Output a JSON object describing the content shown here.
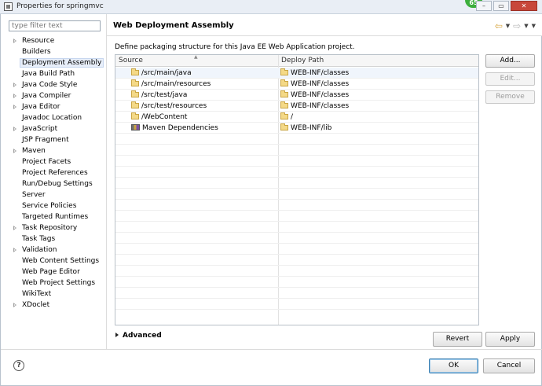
{
  "window": {
    "title": "Properties for springmvc",
    "badge": "65",
    "minimize": "–",
    "restore": "▭",
    "close": "✕"
  },
  "sidebar": {
    "filter_placeholder": "type filter text",
    "items": [
      {
        "label": "Resource",
        "expandable": true
      },
      {
        "label": "Builders",
        "expandable": false
      },
      {
        "label": "Deployment Assembly",
        "expandable": false,
        "selected": true
      },
      {
        "label": "Java Build Path",
        "expandable": false
      },
      {
        "label": "Java Code Style",
        "expandable": true
      },
      {
        "label": "Java Compiler",
        "expandable": true
      },
      {
        "label": "Java Editor",
        "expandable": true
      },
      {
        "label": "Javadoc Location",
        "expandable": false
      },
      {
        "label": "JavaScript",
        "expandable": true
      },
      {
        "label": "JSP Fragment",
        "expandable": false
      },
      {
        "label": "Maven",
        "expandable": true
      },
      {
        "label": "Project Facets",
        "expandable": false
      },
      {
        "label": "Project References",
        "expandable": false
      },
      {
        "label": "Run/Debug Settings",
        "expandable": false
      },
      {
        "label": "Server",
        "expandable": false
      },
      {
        "label": "Service Policies",
        "expandable": false
      },
      {
        "label": "Targeted Runtimes",
        "expandable": false
      },
      {
        "label": "Task Repository",
        "expandable": true
      },
      {
        "label": "Task Tags",
        "expandable": false
      },
      {
        "label": "Validation",
        "expandable": true
      },
      {
        "label": "Web Content Settings",
        "expandable": false
      },
      {
        "label": "Web Page Editor",
        "expandable": false
      },
      {
        "label": "Web Project Settings",
        "expandable": false
      },
      {
        "label": "WikiText",
        "expandable": false
      },
      {
        "label": "XDoclet",
        "expandable": true
      }
    ]
  },
  "header": {
    "title": "Web Deployment Assembly",
    "back_icon": "⇦",
    "forward_icon": "⇨",
    "dropdown_icon": "▼"
  },
  "main": {
    "description": "Define packaging structure for this Java EE Web Application project.",
    "columns": [
      "Source",
      "Deploy Path"
    ],
    "sort_caret": "▲",
    "rows": [
      {
        "source": "/src/main/java",
        "deploy": "WEB-INF/classes",
        "icon": "folder-icon",
        "selected": true
      },
      {
        "source": "/src/main/resources",
        "deploy": "WEB-INF/classes",
        "icon": "folder-icon"
      },
      {
        "source": "/src/test/java",
        "deploy": "WEB-INF/classes",
        "icon": "folder-icon"
      },
      {
        "source": "/src/test/resources",
        "deploy": "WEB-INF/classes",
        "icon": "folder-icon"
      },
      {
        "source": "/WebContent",
        "deploy": "/",
        "icon": "folder-icon"
      },
      {
        "source": "Maven Dependencies",
        "deploy": "WEB-INF/lib",
        "icon": "library-icon"
      }
    ],
    "buttons": {
      "add": "Add...",
      "edit": "Edit...",
      "remove": "Remove"
    },
    "advanced_label": "Advanced",
    "revert": "Revert",
    "apply": "Apply"
  },
  "footer": {
    "help": "?",
    "ok": "OK",
    "cancel": "Cancel"
  }
}
